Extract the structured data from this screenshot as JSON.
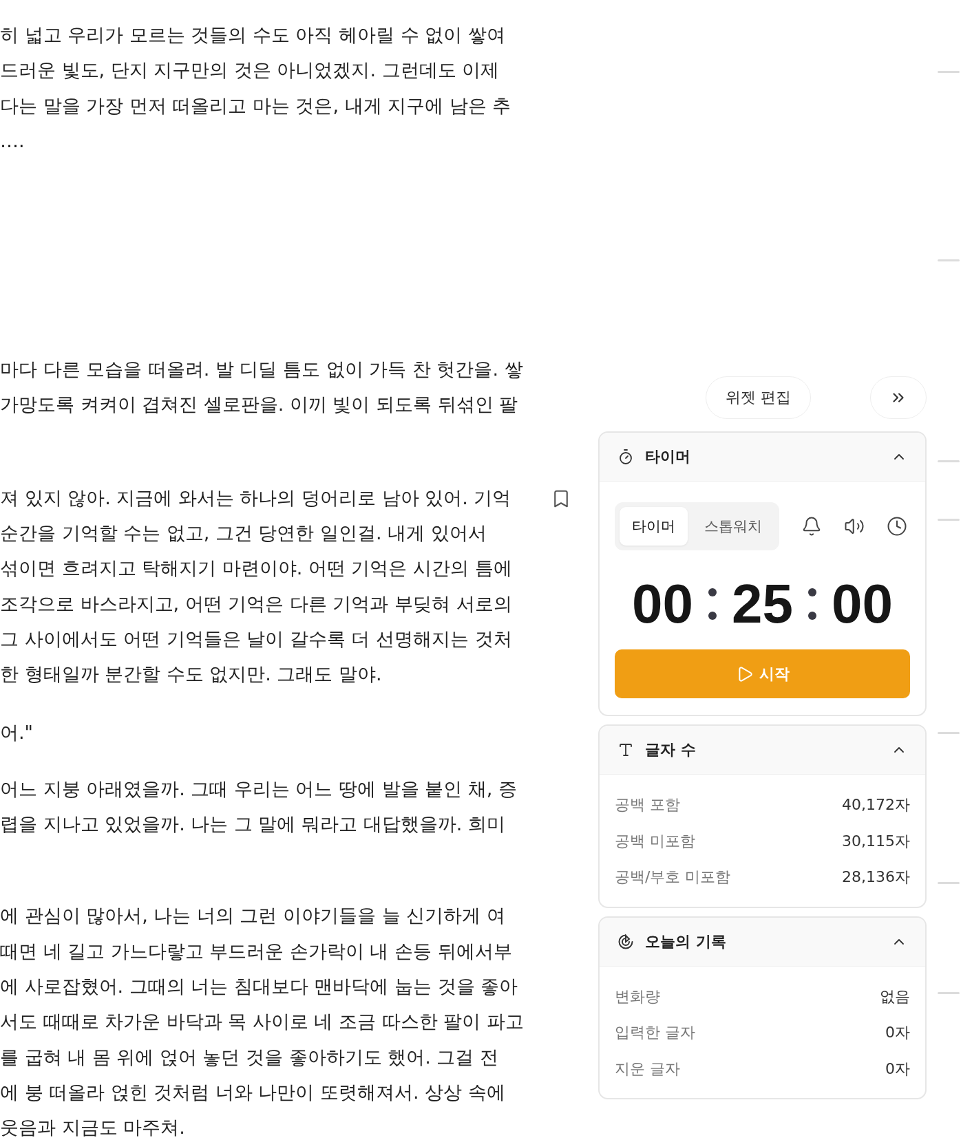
{
  "manuscript": {
    "paragraphs": [
      {
        "lines": [
          "히 넓고 우리가 모르는 것들의 수도 아직 헤아릴 수 없이 쌓여",
          "드러운 빛도, 단지 지구만의 것은 아니었겠지. 그런데도 이제",
          "다는 말을 가장 먼저 떠올리고 마는 것은, 내게 지구에 남은 추",
          "…."
        ]
      },
      {
        "lines": [
          "마다 다른 모습을 떠올려. 발 디딜 틈도 없이 가득 찬 헛간을. 쌓",
          "가망도록 켜켜이 겹쳐진 셀로판을. 이끼 빛이 되도록 뒤섞인 팔"
        ]
      },
      {
        "lines": [
          "져 있지 않아. 지금에 와서는 하나의 덩어리로 남아 있어. 기억",
          "순간을 기억할 수는 없고, 그건 당연한 일인걸. 내게 있어서",
          "섞이면 흐려지고 탁해지기 마련이야. 어떤 기억은 시간의 틈에",
          "조각으로 바스라지고, 어떤 기억은 다른 기억과 부딪혀 서로의",
          "그 사이에서도 어떤 기억들은 날이 갈수록 더 선명해지는 것처",
          "한 형태일까 분간할 수도 없지만. 그래도 말야."
        ]
      },
      {
        "lines": [
          "어.\""
        ]
      },
      {
        "lines": [
          "어느 지붕 아래였을까. 그때 우리는 어느 땅에 발을 붙인 채, 증",
          "렵을 지나고 있었을까. 나는 그 말에 뭐라고 대답했을까. 희미"
        ]
      },
      {
        "lines": [
          "에 관심이 많아서, 나는 너의 그런 이야기들을 늘 신기하게 여",
          "때면 네 길고 가느다랗고 부드러운 손가락이 내 손등 뒤에서부",
          "에 사로잡혔어. 그때의 너는 침대보다 맨바닥에 눕는 것을 좋아",
          "서도 때때로 차가운 바닥과 목 사이로 네 조금 따스한 팔이 파고",
          "를 굽혀 내 몸 위에 얹어 놓던 것을 좋아하기도 했어. 그걸 전",
          "에 붕 떠올라 얹힌 것처럼 너와 나만이 또렷해져서. 상상 속에",
          "웃음과 지금도 마주쳐."
        ]
      }
    ]
  },
  "panel": {
    "edit_button": "위젯 편집",
    "widgets": [
      {
        "kind": "timer",
        "title": "타이머",
        "expanded": true,
        "modes": [
          {
            "label": "타이머",
            "selected": true
          },
          {
            "label": "스톱워치",
            "selected": false
          }
        ],
        "time": {
          "hours": "00",
          "minutes": "25",
          "seconds": "00"
        },
        "start_label": "시작"
      },
      {
        "kind": "char_count",
        "title": "글자 수",
        "expanded": true,
        "rows": [
          {
            "label": "공백 포함",
            "value": "40,172자"
          },
          {
            "label": "공백 미포함",
            "value": "30,115자"
          },
          {
            "label": "공백/부호 미포함",
            "value": "28,136자"
          }
        ]
      },
      {
        "kind": "daily_record",
        "title": "오늘의 기록",
        "expanded": true,
        "rows": [
          {
            "label": "변화량",
            "value": "없음"
          },
          {
            "label": "입력한 글자",
            "value": "0자"
          },
          {
            "label": "지운 글자",
            "value": "0자"
          }
        ]
      }
    ]
  }
}
